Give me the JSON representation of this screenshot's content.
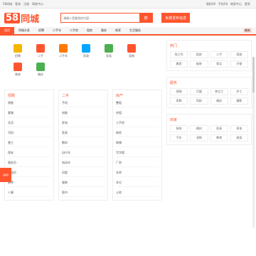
{
  "topbar": {
    "left": [
      "58同城",
      "登录",
      "注册",
      "帮助中心"
    ],
    "right": [
      "我的58",
      "手机58",
      "商家中心",
      "更多"
    ]
  },
  "header": {
    "logo_badge": "58",
    "logo_text": "同城",
    "search_placeholder": "请输入您要找的内容...",
    "search_btn": "搜",
    "post_btn": "免费发布信息"
  },
  "navbar": {
    "items": [
      "首页",
      "同城头条",
      "招聘",
      "二手车",
      "二手房",
      "租房",
      "服务",
      "商家",
      "生活服务"
    ],
    "active_index": 0,
    "badge": "最新"
  },
  "icons": [
    {
      "label": "招聘",
      "color": "#f7b500"
    },
    {
      "label": "二手",
      "color": "#ff552e"
    },
    {
      "label": "二手车",
      "color": "#ff7a00"
    },
    {
      "label": "家政",
      "color": "#00a6ff"
    },
    {
      "label": "家具",
      "color": "#4caf50"
    },
    {
      "label": "宠物",
      "color": "#ff552e"
    },
    {
      "label": "装修",
      "color": "#ff552e"
    },
    {
      "label": "婚庆",
      "color": "#4caf50"
    }
  ],
  "sections": [
    {
      "title": "招聘",
      "rows": [
        "销售",
        "客服",
        "文员",
        "司机",
        "普工",
        "保安",
        "服务员",
        "收银员",
        "厨师",
        "人事"
      ]
    },
    {
      "title": "二手",
      "rows": [
        "手机",
        "电脑",
        "家电",
        "家具",
        "数码",
        "自行车",
        "电动车",
        "母婴",
        "服装",
        "图书"
      ]
    },
    {
      "title": "房产",
      "rows": [
        "整租",
        "合租",
        "二手房",
        "新房",
        "商铺",
        "写字楼",
        "厂房",
        "仓库",
        "车位",
        "土地"
      ]
    }
  ],
  "right_cards": [
    {
      "title": "热门",
      "grid": [
        "找工作",
        "租房",
        "二手",
        "家政",
        "搬家",
        "维修",
        "保洁",
        "开锁"
      ]
    },
    {
      "title": "服务",
      "grid": [
        "保姆",
        "月嫂",
        "钟点工",
        "护工",
        "家教",
        "驾校",
        "婚庆",
        "摄影"
      ]
    },
    {
      "title": "商家",
      "grid": [
        "装修",
        "建材",
        "家具",
        "家电",
        "汽车",
        "宠物",
        "教育",
        "旅游"
      ]
    }
  ],
  "side": {
    "label": "APP"
  }
}
